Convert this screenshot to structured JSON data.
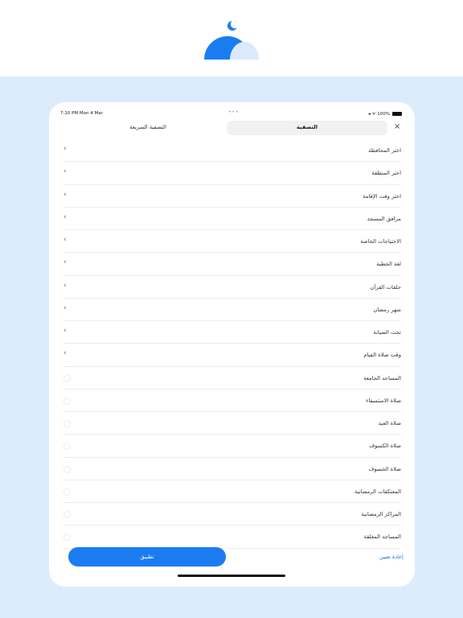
{
  "colors": {
    "accent": "#1b7cf2",
    "background": "#ddecfd",
    "logo_light": "#dbe9fb"
  },
  "status_bar": {
    "time": "7:10 PM  Mon 4 Mar",
    "dots": "•••",
    "right": "◂ ᯤ 100%"
  },
  "tabs": {
    "filter": "التصفية",
    "quick_filter": "التصفية السريعة",
    "close": "×"
  },
  "items": [
    {
      "label": "اختر المحافظة",
      "type": "chevron"
    },
    {
      "label": "اختر المنطقة",
      "type": "chevron"
    },
    {
      "label": "اختر وقت الإقامة",
      "type": "chevron"
    },
    {
      "label": "مرافق المسجد",
      "type": "chevron"
    },
    {
      "label": "الاحتياجات الخاصة",
      "type": "chevron"
    },
    {
      "label": "لغة الخطبة",
      "type": "chevron"
    },
    {
      "label": "حلقات القرآن",
      "type": "chevron"
    },
    {
      "label": "شهر رمضان",
      "type": "chevron"
    },
    {
      "label": "تحت الصيانة",
      "type": "chevron"
    },
    {
      "label": "وقت صلاة القيام",
      "type": "chevron"
    },
    {
      "label": "المساجد الجامعة",
      "type": "radio"
    },
    {
      "label": "صلاة الاستسقاء",
      "type": "radio"
    },
    {
      "label": "صلاة العيد",
      "type": "radio"
    },
    {
      "label": "صلاة الكسوف",
      "type": "radio"
    },
    {
      "label": "صلاة الخسوف",
      "type": "radio"
    },
    {
      "label": "المعتكفات الرمضانية",
      "type": "radio"
    },
    {
      "label": "المراكز الرمضانية",
      "type": "radio"
    },
    {
      "label": "المساجد المغلقة",
      "type": "radio"
    }
  ],
  "footer": {
    "apply": "تطبيق",
    "reset": "إعادة تعيين"
  }
}
